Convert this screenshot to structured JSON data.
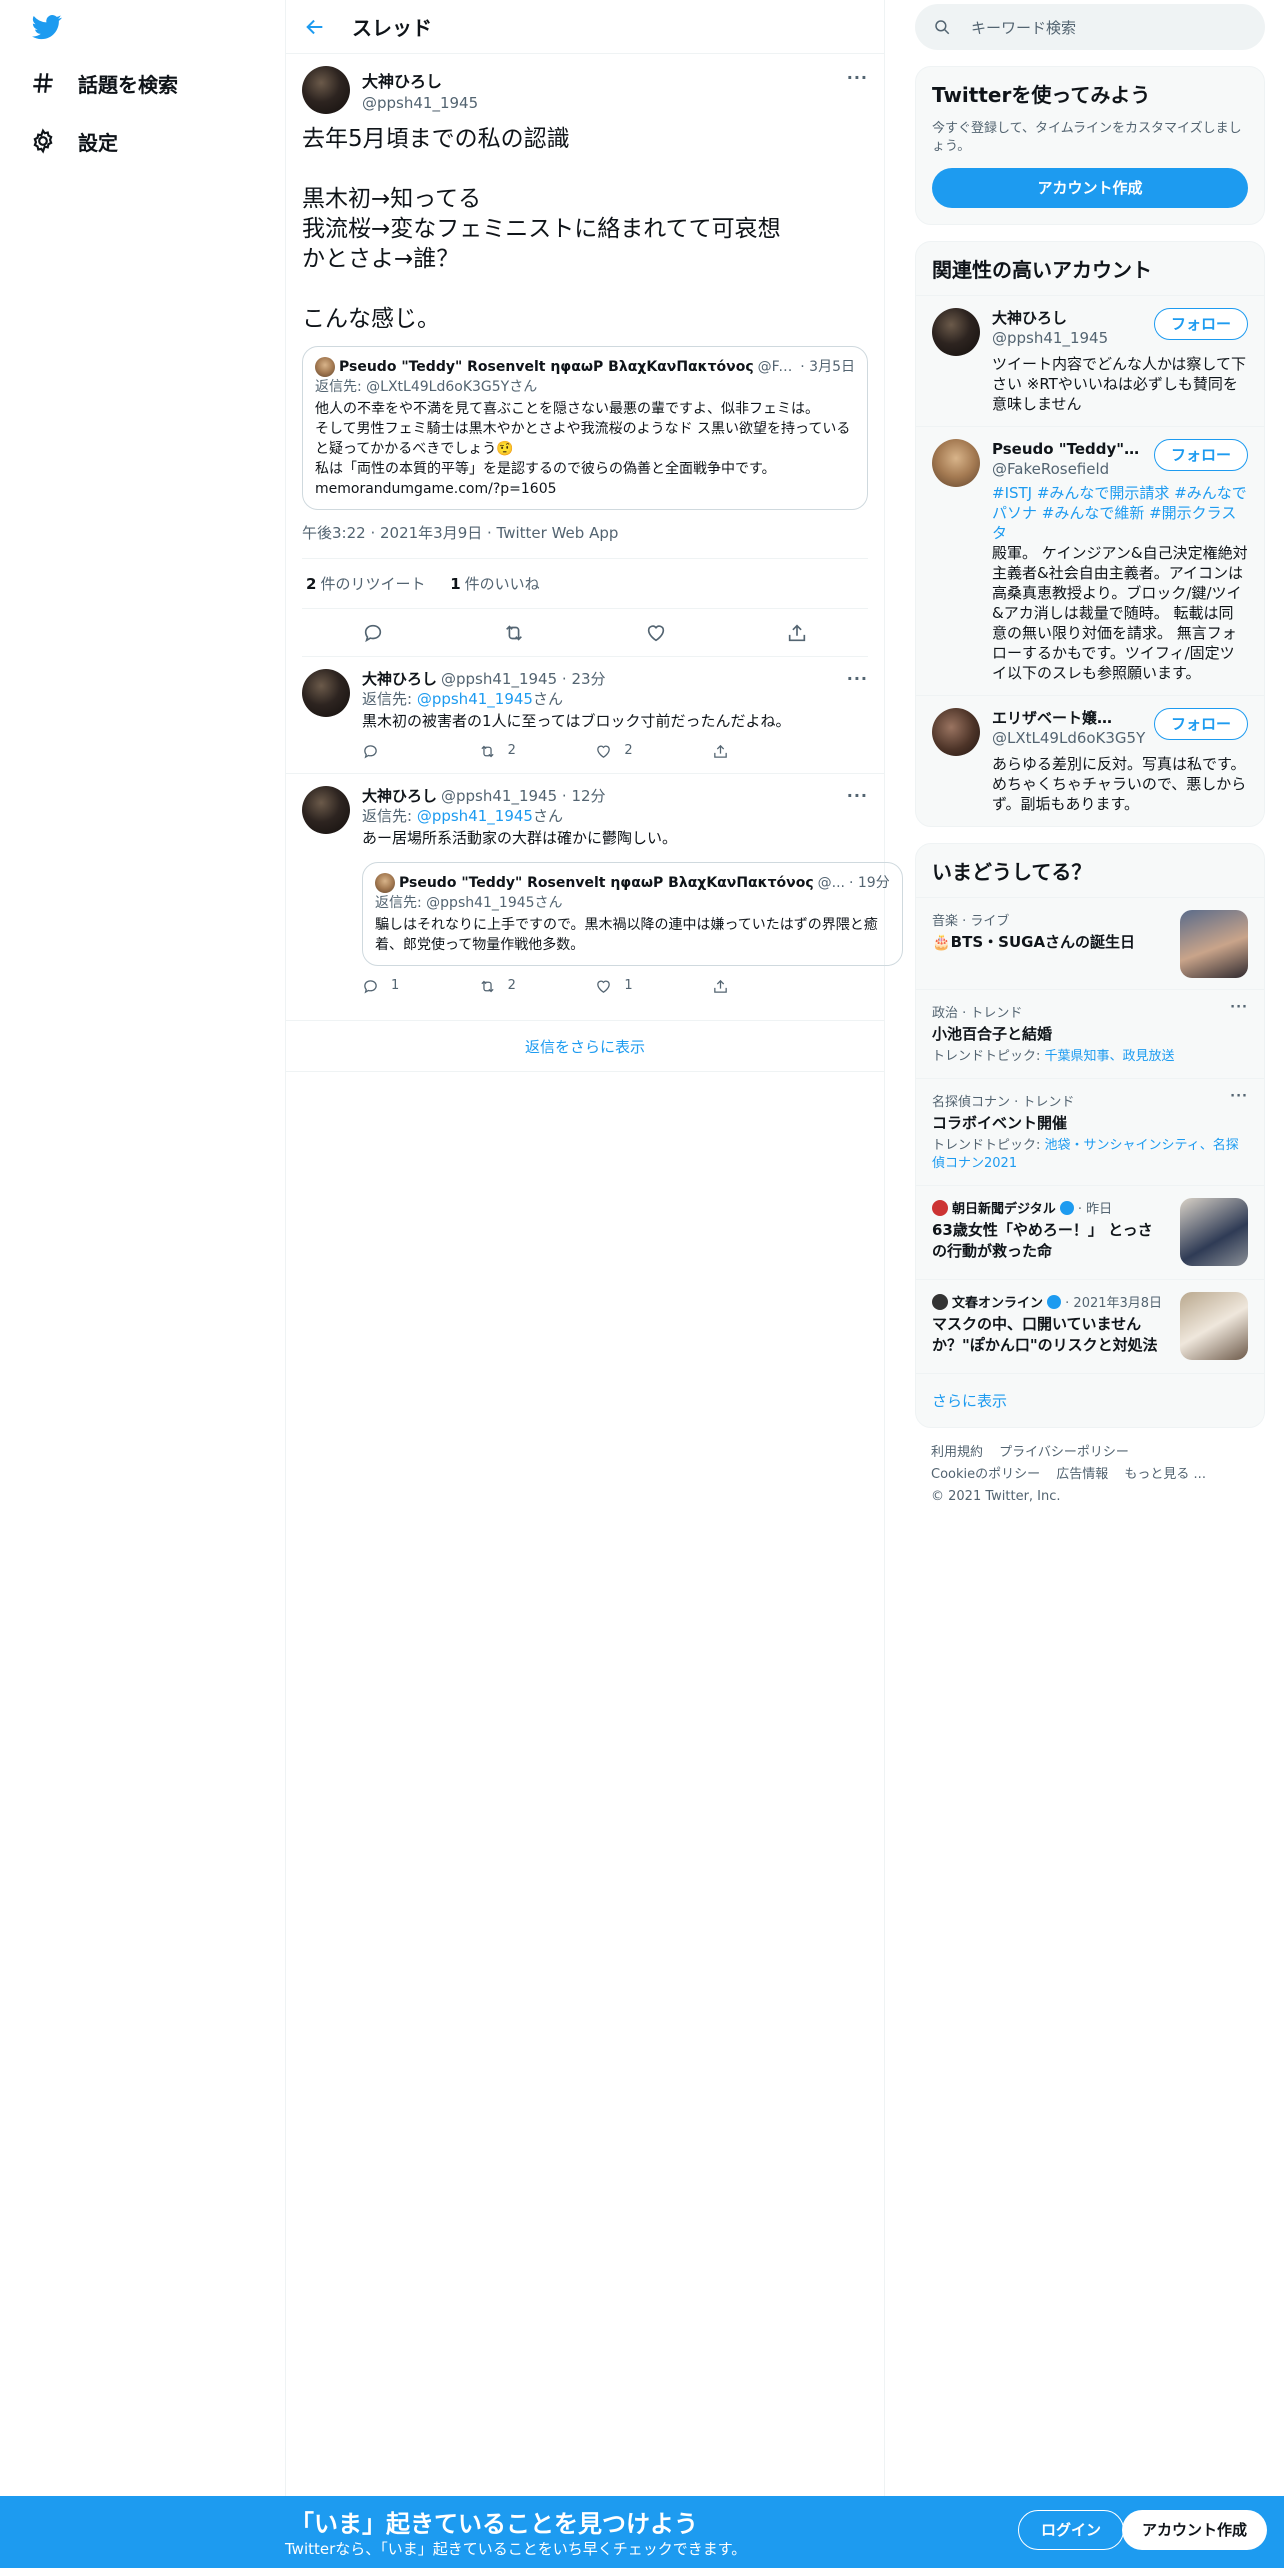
{
  "nav": {
    "explore": "話題を検索",
    "settings": "設定"
  },
  "header": {
    "title": "スレッド"
  },
  "main_tweet": {
    "name": "大神ひろし",
    "handle": "@ppsh41_1945",
    "text": "去年5月頃までの私の認識\n\n黒木初→知ってる\n我流桜→変なフェミニストに絡まれてて可哀想\nかとさよ→誰？\n\nこんな感じ。",
    "quote": {
      "name": "Pseudo \"Teddy\" Rosenvelt ηφαωΡ ΒλαχΚανΠακτόνος",
      "handle": "@FakeRosefield",
      "date": "· 3月5日",
      "reply_to": "返信先: @LXtL49Ld6oK3G5Yさん",
      "text": "他人の不幸をや不満を見て喜ぶことを隠さない最悪の輩ですよ、似非フェミは。\nそして男性フェミ騎士は黒木やかとさよや我流桜のようなド ス黒い欲望を持っていると疑ってかかるべきでしょう🤨\n私は「両性の本質的平等」を是認するので彼らの偽善と全面戦争中です。\nmemorandumgame.com/?p=1605"
    },
    "timestamp": "午後3:22 · 2021年3月9日 · Twitter Web App",
    "retweets_count": "2",
    "retweets_label": "件のリツイート",
    "likes_count": "1",
    "likes_label": "件のいいね"
  },
  "replies": [
    {
      "name": "大神ひろし",
      "handle": "@ppsh41_1945 · 23分",
      "reply_prefix": "返信先: ",
      "reply_handle": "@ppsh41_1945",
      "reply_suffix": "さん",
      "text": "黒木初の被害者の1人に至ってはブロック寸前だったんだよね。",
      "retweets": "2",
      "likes": "2"
    },
    {
      "name": "大神ひろし",
      "handle": "@ppsh41_1945 · 12分",
      "reply_prefix": "返信先: ",
      "reply_handle": "@ppsh41_1945",
      "reply_suffix": "さん",
      "text": "あー居場所系活動家の大群は確かに鬱陶しい。",
      "quote": {
        "name": "Pseudo \"Teddy\" Rosenvelt ηφαωΡ ΒλαχΚανΠακτόνος",
        "handle": "@...",
        "date": "· 19分",
        "reply_to": "返信先: @ppsh41_1945さん",
        "text": "騙しはそれなりに上手ですので。黒木禍以降の連中は嫌っていたはずの界隈と癒着、郎党使って物量作戦他多数。"
      },
      "replies": "1",
      "retweets": "2",
      "likes": "1"
    }
  ],
  "show_more_replies": "返信をさらに表示",
  "search": {
    "placeholder": "キーワード検索"
  },
  "signup_card": {
    "title": "Twitterを使ってみよう",
    "desc": "今すぐ登録して、タイムラインをカスタマイズしましょう。",
    "button": "アカウント作成"
  },
  "related": {
    "title": "関連性の高いアカウント",
    "follow_label": "フォロー",
    "accounts": [
      {
        "name": "大神ひろし",
        "handle": "@ppsh41_1945",
        "bio": "ツイート内容でどんな人かは察して下さい ※RTやいいねは必ずしも賛同を意味しません"
      },
      {
        "name": "Pseudo \"Teddy\" Ros...",
        "handle": "@FakeRosefield",
        "hashtags": "#ISTJ #みんなで開示請求 #みんなでパソナ #みんなで維新 #開示クラスタ",
        "bio": "殿軍。 ケインジアン&自己決定権絶対主義者&社会自由主義者。アイコンは高桑真恵教授より。ブロック/鍵/ツイ&アカ消しは裁量で随時。 転載は同意の無い限り対価を請求。 無言フォローするかもです。ツイフィ/固定ツイ以下のスレも参照願います。"
      },
      {
        "name": "エリザベート嬢@献...",
        "handle": "@LXtL49Ld6oK3G5Y",
        "bio": "あらゆる差別に反対。写真は私です。めちゃくちゃチャラいので、悪しからず。副垢もあります。"
      }
    ]
  },
  "trends": {
    "title": "いまどうしてる？",
    "items": [
      {
        "context": "音楽 · ライブ",
        "title": "🎂BTS・SUGAさんの誕生日",
        "image": true
      },
      {
        "context": "政治 · トレンド",
        "title": "小池百合子と結婚",
        "sub_prefix": "トレンドトピック: ",
        "sub_links": "千葉県知事、政見放送"
      },
      {
        "context": "名探偵コナン · トレンド",
        "title": "コラボイベント開催",
        "sub_prefix": "トレンドトピック: ",
        "sub_links": "池袋・サンシャインシティ、名探偵コナン2021"
      },
      {
        "source": "朝日新聞デジタル",
        "time": "· 昨日",
        "title": "63歳女性「やめろー！」 とっさの行動が救った命",
        "image": true
      },
      {
        "source": "文春オンライン",
        "time": "· 2021年3月8日",
        "title": "マスクの中、口開いていませんか？\"ぽかん口\"のリスクと対処法",
        "image": true
      }
    ],
    "show_more": "さらに表示"
  },
  "footer": {
    "links": [
      "利用規約",
      "プライバシーポリシー",
      "Cookieのポリシー",
      "広告情報",
      "もっと見る ..."
    ],
    "copyright": "© 2021 Twitter, Inc."
  },
  "bottom_bar": {
    "title": "「いま」起きていることを見つけよう",
    "subtitle": "Twitterなら、「いま」起きていることをいち早くチェックできます。",
    "login": "ログイン",
    "signup": "アカウント作成"
  },
  "colors": {
    "accent": "#1d9bf0",
    "text": "#0f1419",
    "muted": "#536471"
  }
}
